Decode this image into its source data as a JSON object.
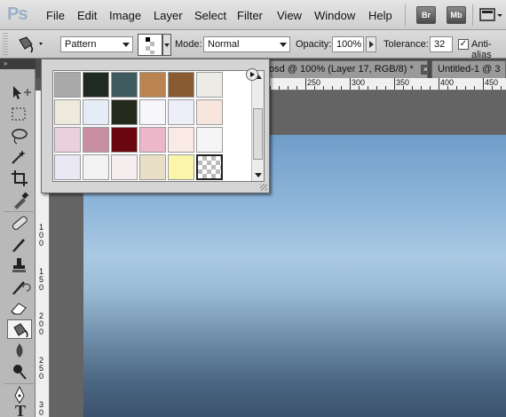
{
  "app": {
    "logo_text": "Ps"
  },
  "menu": {
    "items": [
      "File",
      "Edit",
      "Image",
      "Layer",
      "Select",
      "Filter",
      "View",
      "Window",
      "Help"
    ],
    "launch_buttons": [
      "Br",
      "Mb"
    ]
  },
  "options": {
    "fill_source": "Pattern",
    "mode_label": "Mode:",
    "mode_value": "Normal",
    "opacity_label": "Opacity:",
    "opacity_value": "100%",
    "tolerance_label": "Tolerance:",
    "tolerance_value": "32",
    "antialias_label": "Anti-alias",
    "antialias_checked": true
  },
  "documents": {
    "tabs": [
      {
        "title": "osd @ 100% (Layer 17, RGB/8) *",
        "close": "×"
      },
      {
        "title": "Untitled-1 @ 3",
        "close": ""
      }
    ]
  },
  "rulers": {
    "top_labels": [
      "250",
      "300",
      "350",
      "400",
      "450"
    ],
    "left_labels": [
      "1\n0\n0",
      "1\n5\n0",
      "2\n0\n0",
      "2\n5\n0",
      "3\n0\n0"
    ]
  },
  "pattern_picker": {
    "swatches": [
      {
        "name": "gray-pinstripe-pattern",
        "color": "#a9a9a9"
      },
      {
        "name": "dark-green-rock-pattern",
        "color": "#1f2a22"
      },
      {
        "name": "slate-texture-pattern",
        "color": "#3f5a5e"
      },
      {
        "name": "tan-leather-pattern",
        "color": "#b98450"
      },
      {
        "name": "brown-wood-pattern",
        "color": "#8a5a32"
      },
      {
        "name": "white-crumpled-paper-pattern",
        "color": "#ecebe6"
      },
      {
        "name": "beige-canvas-pattern",
        "color": "#ede9dc"
      },
      {
        "name": "light-blue-paper-pattern",
        "color": "#e4edf7"
      },
      {
        "name": "dark-olive-pattern",
        "color": "#242a1c"
      },
      {
        "name": "white-fibers-pattern",
        "color": "#f7f7fb"
      },
      {
        "name": "pale-lavender-pattern",
        "color": "#eceef8"
      },
      {
        "name": "peach-paper-pattern",
        "color": "#f6e6dd"
      },
      {
        "name": "pink-paper-pattern",
        "color": "#ead0dc"
      },
      {
        "name": "mauve-fabric-pattern",
        "color": "#c88fa4"
      },
      {
        "name": "dark-red-pattern",
        "color": "#6a0610"
      },
      {
        "name": "rose-stripe-pattern",
        "color": "#ecb7c8"
      },
      {
        "name": "cream-paper-pattern",
        "color": "#f9ebe3"
      },
      {
        "name": "white-pattern",
        "color": "#f5f5f5"
      },
      {
        "name": "lilac-paper-pattern",
        "color": "#ebe8f5"
      },
      {
        "name": "snow-white-pattern",
        "color": "#f3f3f3"
      },
      {
        "name": "blush-white-pattern",
        "color": "#f6eeee"
      },
      {
        "name": "parchment-pattern",
        "color": "#e9dfc6"
      },
      {
        "name": "pale-yellow-pattern",
        "color": "#fbf5a9"
      },
      {
        "name": "checker-transparent-pattern",
        "color": "#ffffff"
      }
    ]
  },
  "colors": {
    "accent": "#3d6fa5",
    "canvas_top": "#6f9dc9",
    "canvas_bottom": "#3c536e"
  }
}
